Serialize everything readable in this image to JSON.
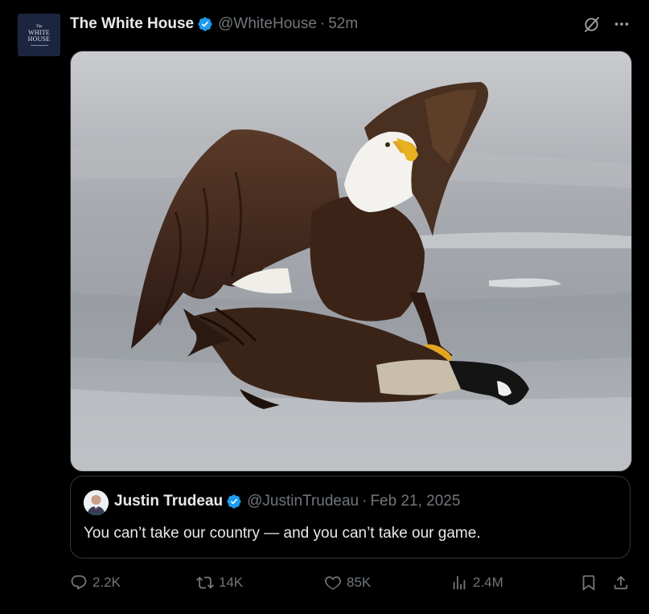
{
  "post": {
    "author": {
      "name": "The White House",
      "handle": "@WhiteHouse",
      "time": "52m",
      "avatar_text_small": "The",
      "avatar_text_line1": "WHITE",
      "avatar_text_line2": "HOUSE"
    },
    "media": {
      "description_icon": "eagle-photo"
    },
    "quote": {
      "name": "Justin Trudeau",
      "handle": "@JustinTrudeau",
      "date": "Feb 21, 2025",
      "text": "You can’t take our country — and you can’t take our game."
    },
    "stats": {
      "replies": "2.2K",
      "reposts": "14K",
      "likes": "85K",
      "views": "2.4M"
    }
  },
  "separators": {
    "dot": "·"
  },
  "colors": {
    "background": "#000000",
    "text": "#e7e9ea",
    "muted": "#71767b",
    "border": "#333639",
    "verified": "#1d9bf0"
  }
}
